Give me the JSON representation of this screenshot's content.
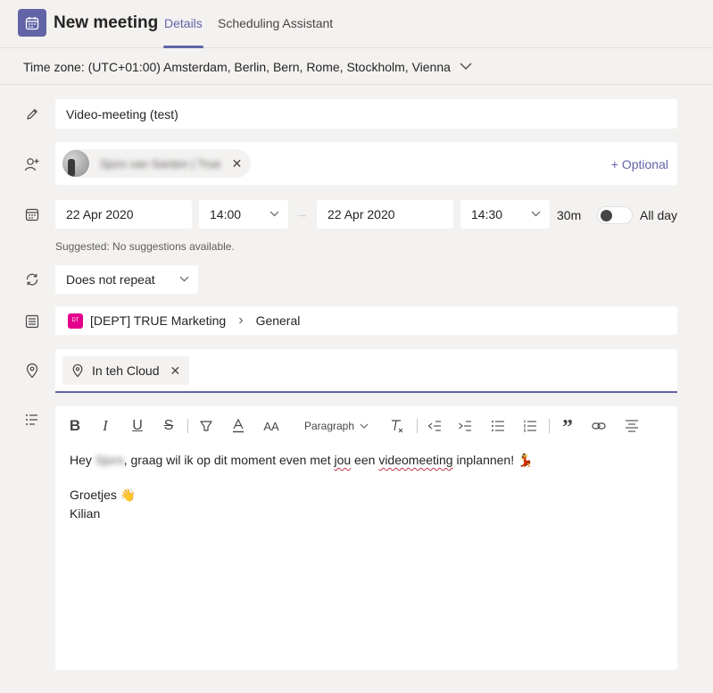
{
  "header": {
    "title": "New meeting",
    "tabs": [
      {
        "label": "Details",
        "active": true
      },
      {
        "label": "Scheduling Assistant",
        "active": false
      }
    ]
  },
  "timezone": {
    "label": "Time zone: (UTC+01:00) Amsterdam, Berlin, Bern, Rome, Stockholm, Vienna"
  },
  "meeting": {
    "title_value": "Video-meeting (test)"
  },
  "attendees": {
    "chip_name": "Sjors van Santen | True",
    "remove_symbol": "✕",
    "optional_label": "+ Optional"
  },
  "schedule": {
    "start_date": "22 Apr 2020",
    "start_time": "14:00",
    "end_date": "22 Apr 2020",
    "end_time": "14:30",
    "duration": "30m",
    "all_day_label": "All day",
    "all_day_on": false,
    "arrow": "→",
    "suggestion": "Suggested: No suggestions available."
  },
  "repeat": {
    "value": "Does not repeat"
  },
  "channel": {
    "badge": "DT",
    "team": "[DEPT] TRUE Marketing",
    "separator": "›",
    "channel": "General"
  },
  "location": {
    "value": "In teh Cloud",
    "remove_symbol": "✕"
  },
  "editor": {
    "toolbar": {
      "bold": "B",
      "italic": "I",
      "underline": "U",
      "strike": "S",
      "font_size": "AA",
      "paragraph": "Paragraph",
      "quote": "”"
    },
    "line1": {
      "part1": "Hey ",
      "blurred_name": "Sjors",
      "part2": ", graag wil ik op dit moment even met ",
      "word_jou": "jou",
      "part3": " een ",
      "word_video": "videomeeting",
      "part4": " inplannen! ",
      "emoji": "💃"
    },
    "line2": {
      "text": "Groetjes ",
      "emoji": "👋"
    },
    "line3": "Kilian"
  },
  "colors": {
    "accent": "#6264a7",
    "background": "#f3f2f1",
    "field": "#ffffff",
    "channel_badge": "#e3008c",
    "spell_error": "#c4314b"
  }
}
